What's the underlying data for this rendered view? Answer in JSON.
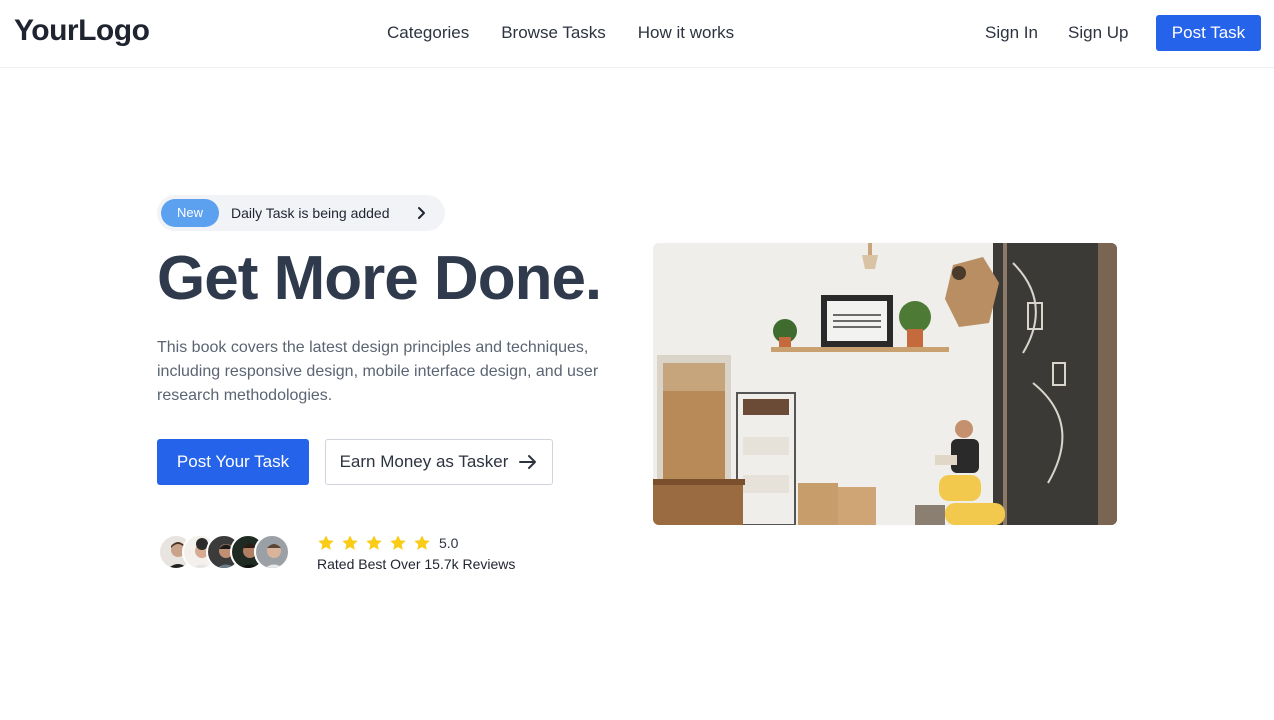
{
  "header": {
    "logo": "YourLogo",
    "nav": [
      "Categories",
      "Browse Tasks",
      "How it works"
    ],
    "sign_in": "Sign In",
    "sign_up": "Sign Up",
    "post_task": "Post Task",
    "accent_color": "#2563eb"
  },
  "hero": {
    "badge": "New",
    "announcement": "Daily Task is being added",
    "headline": "Get More Done.",
    "description": "This book covers the latest design principles and techniques, including responsive design, mobile interface design, and user research methodologies.",
    "primary_cta": "Post Your Task",
    "secondary_cta": "Earn Money as Tasker",
    "rating_value": "5.0",
    "star_count": 5,
    "rated_text": "Rated Best Over 15.7k Reviews",
    "star_color": "#facc15"
  }
}
